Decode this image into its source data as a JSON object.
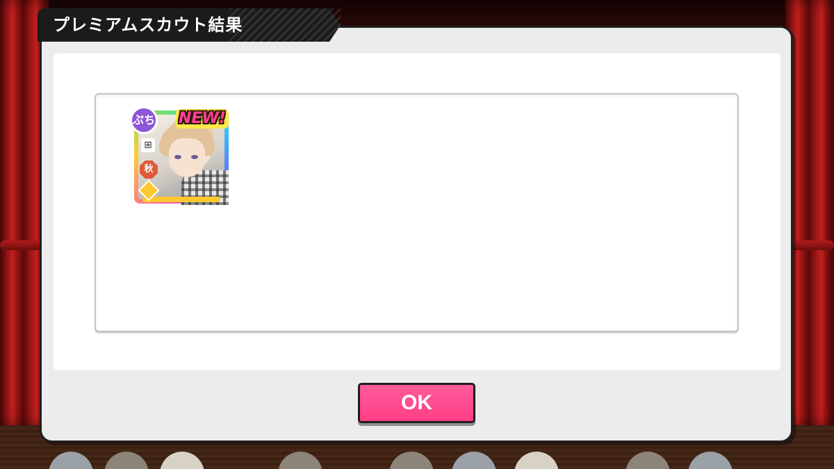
{
  "dialog": {
    "title": "プレミアムスカウト結果"
  },
  "results": [
    {
      "rarity_badge": "ぷち",
      "new_label": "NEW!",
      "season_badge": "秋"
    }
  ],
  "buttons": {
    "ok_label": "OK"
  },
  "colors": {
    "ok_button": "#ff4f90",
    "dialog_border": "#1e1e1e",
    "title_tab": "#1b1b1b",
    "curtain": "#9c1616"
  }
}
